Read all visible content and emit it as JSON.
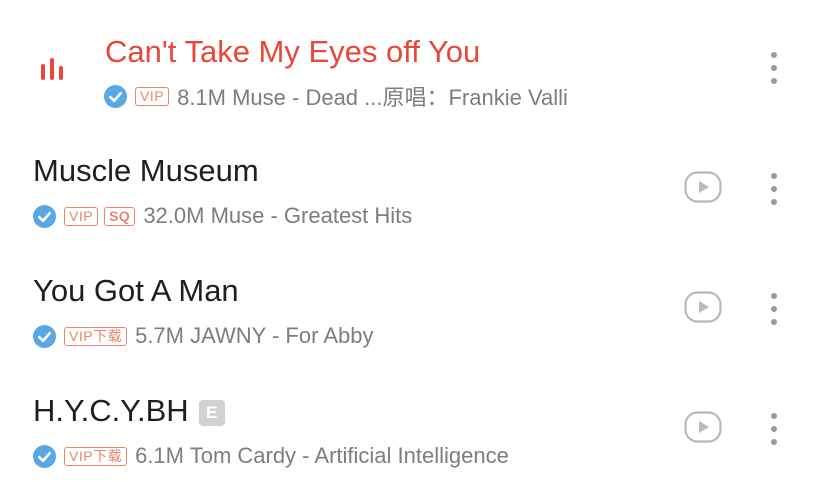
{
  "songs": [
    {
      "title": "Can't Take My Eyes off You",
      "playing": true,
      "explicit": "",
      "tags": [
        "VIP"
      ],
      "meta": "8.1M Muse - Dead ...原唱：Frankie Valli"
    },
    {
      "title": "Muscle Museum",
      "playing": false,
      "explicit": "",
      "tags": [
        "VIP",
        "SQ"
      ],
      "meta": "32.0M Muse - Greatest Hits"
    },
    {
      "title": "You Got A Man",
      "playing": false,
      "explicit": "",
      "tags": [
        "VIP下载"
      ],
      "meta": "5.7M JAWNY - For Abby"
    },
    {
      "title": "H.Y.C.Y.BH",
      "playing": false,
      "explicit": "E",
      "tags": [
        "VIP下载"
      ],
      "meta": "6.1M Tom Cardy - Artificial Intelligence"
    }
  ],
  "icons": {
    "playing": "now-playing-bars-icon",
    "verified": "verified-check-icon",
    "play": "play-circle-icon",
    "more": "more-vertical-icon"
  },
  "colors": {
    "accent": "#e8473a",
    "title": "#1f1f1f",
    "meta": "#7d7d7d",
    "tag": "#e8866e",
    "verified": "#5aa7e6",
    "icon_gray": "#b9b9b9"
  }
}
